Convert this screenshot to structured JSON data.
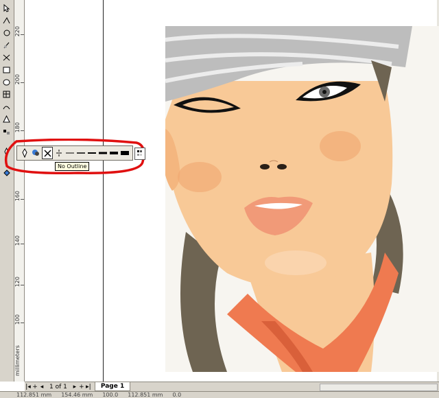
{
  "toolbox": {
    "tools": [
      "pick-icon",
      "shape-icon",
      "crop-icon",
      "zoom-icon",
      "freehand-icon",
      "smart-fill-icon",
      "rectangle-icon",
      "ellipse-icon",
      "polygon-icon",
      "basic-shapes-icon",
      "text-icon",
      "interactive-blend-icon",
      "eyedropper-icon",
      "outline-pen-icon",
      "fill-icon"
    ]
  },
  "ruler": {
    "labels": [
      "220",
      "200",
      "180",
      "160",
      "140",
      "120",
      "100"
    ],
    "units": "millimeters"
  },
  "outline_flyout": {
    "tooltip": "No Outline",
    "buttons": [
      "outline-pen-dialog-icon",
      "outline-color-icon",
      "no-outline-icon",
      "hairline-icon",
      "line-1-icon",
      "line-2-icon",
      "line-3-icon",
      "line-4-icon",
      "line-5-icon",
      "line-6-icon",
      "color-docker-icon"
    ]
  },
  "page_nav": {
    "page_count": "1 of 1",
    "page_tab": "Page 1"
  },
  "status": {
    "x": "112.851 mm",
    "y": "154.46 mm",
    "zoom": "100.0",
    "x2": "112.851 mm",
    "y2": "0.0"
  },
  "colors": {
    "skin": "#f8c997",
    "hair": "#6e6452",
    "scarf": "#ef7a50",
    "lips": "#f19a78",
    "annotation": "#e01010"
  }
}
